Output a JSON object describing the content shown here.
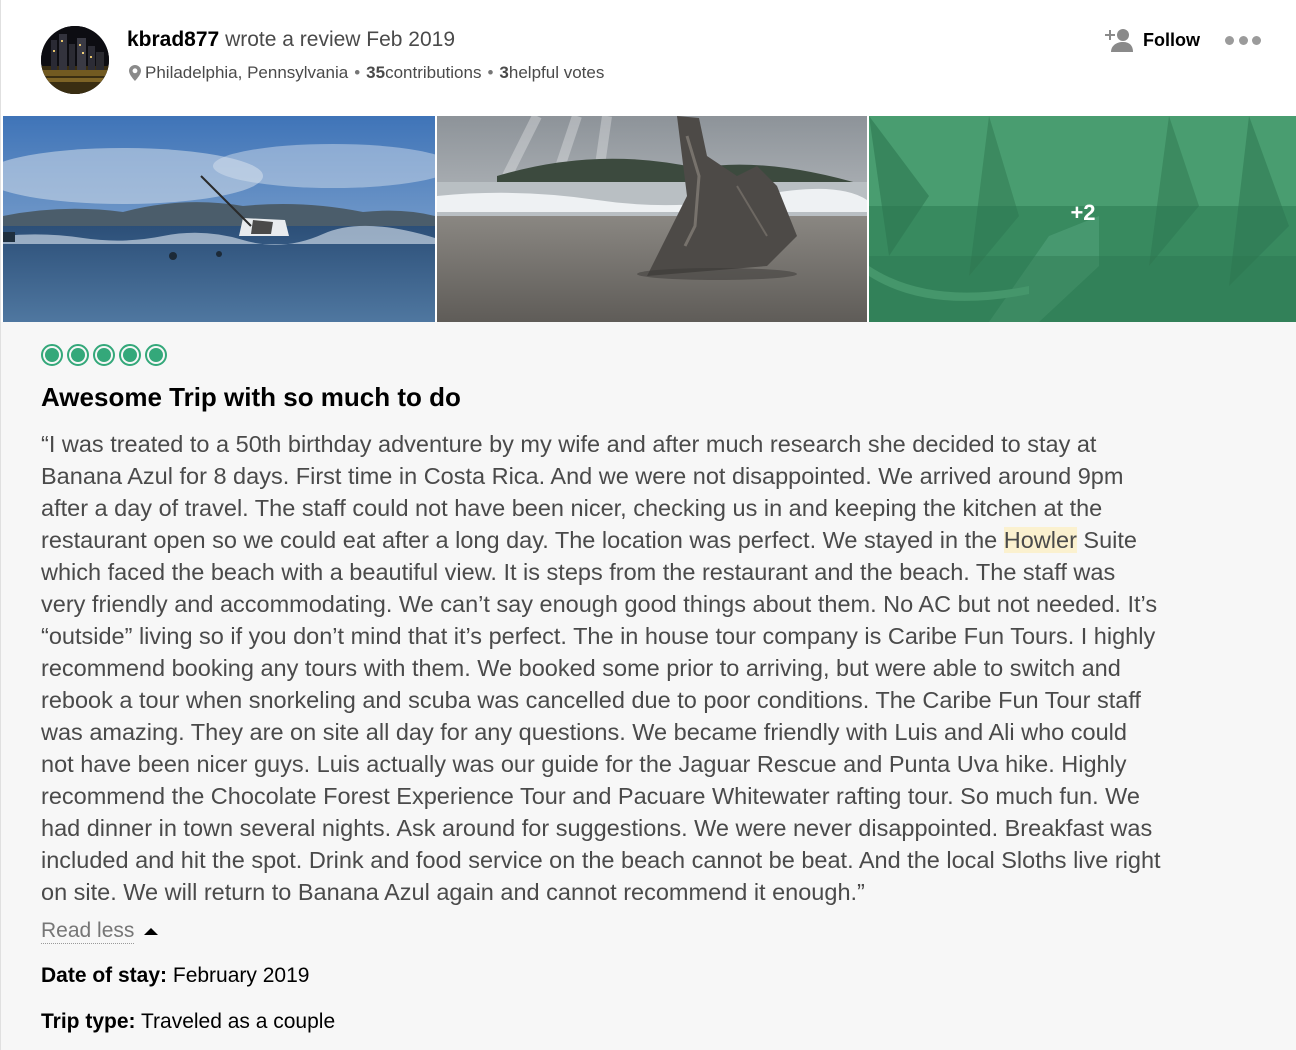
{
  "review": {
    "user": {
      "username": "kbrad877",
      "action_text": " wrote a review Feb 2019",
      "location": "Philadelphia, Pennsylvania",
      "contributions_count": "35",
      "contributions_label": " contributions",
      "separator": "•",
      "helpful_votes_count": "3",
      "helpful_votes_label": " helpful votes"
    },
    "follow_label": "Follow",
    "photos": {
      "more_count_label": "+2"
    },
    "rating": 5,
    "rating_color": "#34a87a",
    "title": "Awesome Trip with so much to do",
    "text_lines": [
      "“I was treated to a 50th birthday adventure by my wife and after much research she decided to stay at",
      "Banana Azul for 8 days. First time in Costa Rica. And we were not disappointed. We arrived around 9pm",
      "after a day of travel. The staff could not have been nicer, checking us in and keeping the kitchen at the",
      "restaurant open so we could eat after a long day. The location was perfect. We stayed in the ",
      "which faced the beach with a beautiful view. It is steps from the restaurant and the beach. The staff was",
      "very friendly and accommodating. We can’t say enough good things about them. No AC but not needed. It’s",
      "“outside” living so if you don’t mind that it’s perfect. The in house tour company is Caribe Fun Tours. I highly",
      "recommend booking any tours with them. We booked some prior to arriving, but were able to switch and",
      "rebook a tour when snorkeling and scuba was cancelled due to poor conditions. The Caribe Fun Tour staff",
      "was amazing. They are on site all day for any questions. We became friendly with Luis and Ali who could",
      "not have been nicer guys. Luis actually was our guide for the Jaguar Rescue and Punta Uva hike. Highly",
      "recommend the Chocolate Forest Experience Tour and Pacuare Whitewater rafting tour. So much fun. We",
      "had dinner in town several nights. Ask around for suggestions. We were never disappointed. Breakfast was",
      "included and hit the spot. Drink and food service on the beach cannot be beat. And the local Sloths live right",
      "on site. We will return to Banana Azul again and cannot recommend it enough.”"
    ],
    "highlight_word": "Howler",
    "highlight_after": " Suite",
    "highlight_color": "#fbf1cf",
    "read_less_label": "Read less",
    "date_of_stay_label": "Date of stay:",
    "date_of_stay_value": " February 2019",
    "trip_type_label": "Trip type:",
    "trip_type_value": " Traveled as a couple"
  },
  "icons": {
    "location": "map-pin-icon",
    "follow": "add-user-icon",
    "more": "more-options-icon",
    "read_less": "caret-up-icon"
  }
}
